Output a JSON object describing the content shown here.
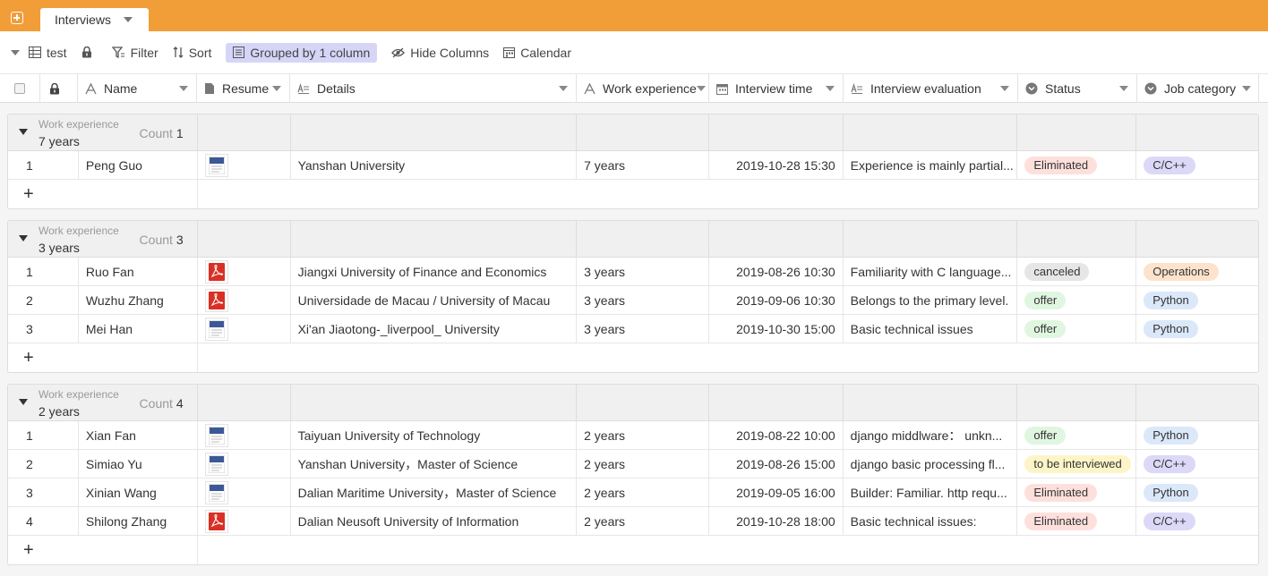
{
  "app": {
    "tab_label": "Interviews"
  },
  "toolbar": {
    "view_name": "test",
    "filter": "Filter",
    "sort": "Sort",
    "grouped": "Grouped by 1 column",
    "hide_columns": "Hide Columns",
    "calendar": "Calendar"
  },
  "columns": {
    "name": "Name",
    "resume": "Resume",
    "details": "Details",
    "work_experience": "Work experience",
    "interview_time": "Interview time",
    "interview_evaluation": "Interview evaluation",
    "status": "Status",
    "job_category": "Job category"
  },
  "colors": {
    "topbar": "#f19d38",
    "grouped_bg": "#d6d5f8",
    "eliminated": "#fde0dc",
    "canceled": "#e6e6e6",
    "offer": "#e0f6e0",
    "to_be_interviewed": "#fdf5c8",
    "cpp": "#dcd8f8",
    "python": "#dbe8fa",
    "operations": "#fde3cc",
    "pdf_red": "#d93025",
    "doc_blue": "#3b5998"
  },
  "groups": [
    {
      "field": "Work experience",
      "value": "7 years",
      "count_label": "Count",
      "count": "1",
      "rows": [
        {
          "idx": "1",
          "name": "Peng Guo",
          "resume": "doc",
          "details": "Yanshan University",
          "work": "7 years",
          "time": "2019-10-28 15:30",
          "eval": "Experience is mainly partial...",
          "status": "Eliminated",
          "status_color": "#fde0dc",
          "job": "C/C++",
          "job_color": "#dcd8f8"
        }
      ]
    },
    {
      "field": "Work experience",
      "value": "3 years",
      "count_label": "Count",
      "count": "3",
      "rows": [
        {
          "idx": "1",
          "name": "Ruo Fan",
          "resume": "pdf",
          "details": "Jiangxi University of Finance and Economics",
          "work": "3 years",
          "time": "2019-08-26 10:30",
          "eval": "Familiarity with C language...",
          "status": "canceled",
          "status_color": "#e6e6e6",
          "job": "Operations",
          "job_color": "#fde3cc"
        },
        {
          "idx": "2",
          "name": "Wuzhu Zhang",
          "resume": "pdf",
          "details": "Universidade de Macau / University of Macau",
          "work": "3 years",
          "time": "2019-09-06 10:30",
          "eval": "Belongs to the primary level.",
          "status": "offer",
          "status_color": "#e0f6e0",
          "job": "Python",
          "job_color": "#dbe8fa"
        },
        {
          "idx": "3",
          "name": "Mei Han",
          "resume": "doc",
          "details": "Xi'an Jiaotong-_liverpool_ University",
          "work": "3 years",
          "time": "2019-10-30 15:00",
          "eval": "Basic technical issues",
          "status": "offer",
          "status_color": "#e0f6e0",
          "job": "Python",
          "job_color": "#dbe8fa"
        }
      ]
    },
    {
      "field": "Work experience",
      "value": "2 years",
      "count_label": "Count",
      "count": "4",
      "rows": [
        {
          "idx": "1",
          "name": "Xian Fan",
          "resume": "doc",
          "details": "Taiyuan University of Technology",
          "work": "2 years",
          "time": "2019-08-22 10:00",
          "eval": "django middlware： unkn...",
          "status": "offer",
          "status_color": "#e0f6e0",
          "job": "Python",
          "job_color": "#dbe8fa"
        },
        {
          "idx": "2",
          "name": "Simiao Yu",
          "resume": "doc",
          "details": "Yanshan University，Master of Science",
          "work": "2 years",
          "time": "2019-08-26 15:00",
          "eval": "django basic processing fl...",
          "status": "to be interviewed",
          "status_color": "#fdf5c8",
          "job": "C/C++",
          "job_color": "#dcd8f8"
        },
        {
          "idx": "3",
          "name": "Xinian Wang",
          "resume": "doc",
          "details": "Dalian Maritime University，Master of Science",
          "work": "2 years",
          "time": "2019-09-05 16:00",
          "eval": "Builder: Familiar. http requ...",
          "status": "Eliminated",
          "status_color": "#fde0dc",
          "job": "Python",
          "job_color": "#dbe8fa"
        },
        {
          "idx": "4",
          "name": "Shilong Zhang",
          "resume": "pdf",
          "details": "Dalian Neusoft University of Information",
          "work": "2 years",
          "time": "2019-10-28 18:00",
          "eval": "Basic technical issues:",
          "status": "Eliminated",
          "status_color": "#fde0dc",
          "job": "C/C++",
          "job_color": "#dcd8f8"
        }
      ]
    }
  ],
  "add_row_symbol": "+"
}
